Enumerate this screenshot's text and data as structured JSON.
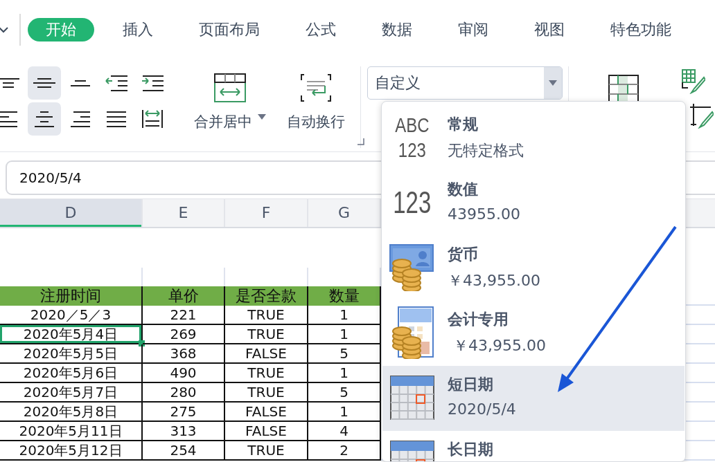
{
  "ribbon_tabs": [
    {
      "label": "开始",
      "selected": true
    },
    {
      "label": "插入",
      "selected": false
    },
    {
      "label": "页面布局",
      "selected": false
    },
    {
      "label": "公式",
      "selected": false
    },
    {
      "label": "数据",
      "selected": false
    },
    {
      "label": "审阅",
      "selected": false
    },
    {
      "label": "视图",
      "selected": false
    },
    {
      "label": "特色功能",
      "selected": false
    }
  ],
  "alignment_buttons": [
    {
      "selected": false
    },
    {
      "selected": true
    },
    {
      "selected": false
    },
    {
      "selected": false
    },
    {
      "selected": false
    },
    {
      "selected": false
    },
    {
      "selected": true
    },
    {
      "selected": false
    },
    {
      "selected": false
    },
    {
      "selected": false
    }
  ],
  "merge_button": {
    "label": "合并居中"
  },
  "wrap_button": {
    "label": "自动换行"
  },
  "number_format": {
    "value": "自定义"
  },
  "formula_bar": {
    "value": "2020/5/4"
  },
  "columns": [
    {
      "label": "D",
      "selected": true
    },
    {
      "label": "E",
      "selected": false
    },
    {
      "label": "F",
      "selected": false
    },
    {
      "label": "G",
      "selected": false
    }
  ],
  "table": {
    "header": [
      "注册时间",
      "单价",
      "是否全款",
      "数量"
    ],
    "rows": [
      {
        "cells": [
          {
            "text": "2020／5／3",
            "selected": false
          },
          {
            "text": "221",
            "selected": false
          },
          {
            "text": "TRUE",
            "selected": false
          },
          {
            "text": "1",
            "selected": false
          }
        ]
      },
      {
        "cells": [
          {
            "text": "2020年5月4日",
            "selected": true
          },
          {
            "text": "269",
            "selected": false
          },
          {
            "text": "TRUE",
            "selected": false
          },
          {
            "text": "1",
            "selected": false
          }
        ]
      },
      {
        "cells": [
          {
            "text": "2020年5月5日",
            "selected": false
          },
          {
            "text": "368",
            "selected": false
          },
          {
            "text": "FALSE",
            "selected": false
          },
          {
            "text": "5",
            "selected": false
          }
        ]
      },
      {
        "cells": [
          {
            "text": "2020年5月6日",
            "selected": false
          },
          {
            "text": "490",
            "selected": false
          },
          {
            "text": "TRUE",
            "selected": false
          },
          {
            "text": "1",
            "selected": false
          }
        ]
      },
      {
        "cells": [
          {
            "text": "2020年5月7日",
            "selected": false
          },
          {
            "text": "280",
            "selected": false
          },
          {
            "text": "TRUE",
            "selected": false
          },
          {
            "text": "5",
            "selected": false
          }
        ]
      },
      {
        "cells": [
          {
            "text": "2020年5月8日",
            "selected": false
          },
          {
            "text": "275",
            "selected": false
          },
          {
            "text": "FALSE",
            "selected": false
          },
          {
            "text": "1",
            "selected": false
          }
        ]
      },
      {
        "cells": [
          {
            "text": "2020年5月11日",
            "selected": false
          },
          {
            "text": "313",
            "selected": false
          },
          {
            "text": "FALSE",
            "selected": false
          },
          {
            "text": "4",
            "selected": false
          }
        ]
      },
      {
        "cells": [
          {
            "text": "2020年5月12日",
            "selected": false
          },
          {
            "text": "254",
            "selected": false
          },
          {
            "text": "TRUE",
            "selected": false
          },
          {
            "text": "2",
            "selected": false
          }
        ]
      }
    ]
  },
  "format_menu": {
    "items": [
      {
        "kind": "general",
        "icon_text": [
          "ABC",
          "123"
        ],
        "label": "常规",
        "example": "无特定格式",
        "selected": false
      },
      {
        "kind": "number",
        "icon_text": [
          "123"
        ],
        "label": "数值",
        "example": "43955.00",
        "selected": false
      },
      {
        "kind": "currency",
        "label": "货币",
        "example": "￥43,955.00",
        "selected": false
      },
      {
        "kind": "accounting",
        "label": "会计专用",
        "example": "￥43,955.00",
        "selected": false
      },
      {
        "kind": "short-date",
        "label": "短日期",
        "example": "2020/5/4",
        "selected": true
      },
      {
        "kind": "long-date",
        "label": "长日期",
        "selected": false
      }
    ]
  }
}
